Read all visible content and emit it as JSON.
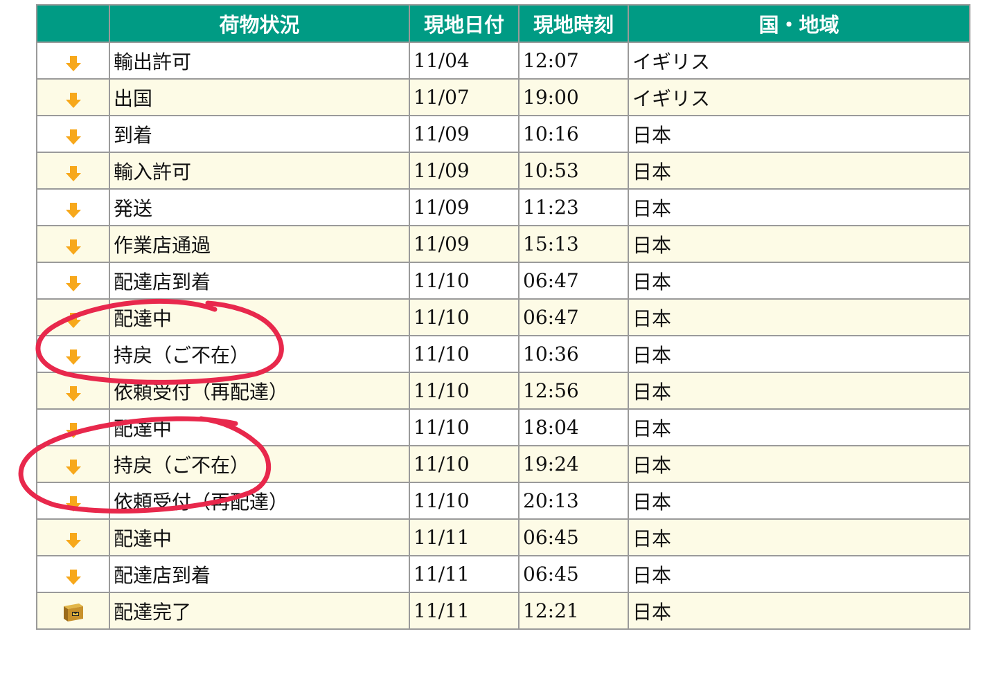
{
  "header": {
    "icon": "",
    "status": "荷物状況",
    "date": "現地日付",
    "time": "現地時刻",
    "region": "国・地域"
  },
  "rows": [
    {
      "icon": "down-arrow-icon",
      "status": "輸出許可",
      "date": "11/04",
      "time": "12:07",
      "region": "イギリス"
    },
    {
      "icon": "down-arrow-icon",
      "status": "出国",
      "date": "11/07",
      "time": "19:00",
      "region": "イギリス"
    },
    {
      "icon": "down-arrow-icon",
      "status": "到着",
      "date": "11/09",
      "time": "10:16",
      "region": "日本"
    },
    {
      "icon": "down-arrow-icon",
      "status": "輸入許可",
      "date": "11/09",
      "time": "10:53",
      "region": "日本"
    },
    {
      "icon": "down-arrow-icon",
      "status": "発送",
      "date": "11/09",
      "time": "11:23",
      "region": "日本"
    },
    {
      "icon": "down-arrow-icon",
      "status": "作業店通過",
      "date": "11/09",
      "time": "15:13",
      "region": "日本"
    },
    {
      "icon": "down-arrow-icon",
      "status": "配達店到着",
      "date": "11/10",
      "time": "06:47",
      "region": "日本"
    },
    {
      "icon": "down-arrow-icon",
      "status": "配達中",
      "date": "11/10",
      "time": "06:47",
      "region": "日本"
    },
    {
      "icon": "down-arrow-icon",
      "status": "持戻（ご不在）",
      "date": "11/10",
      "time": "10:36",
      "region": "日本"
    },
    {
      "icon": "down-arrow-icon",
      "status": "依頼受付（再配達）",
      "date": "11/10",
      "time": "12:56",
      "region": "日本"
    },
    {
      "icon": "down-arrow-icon",
      "status": "配達中",
      "date": "11/10",
      "time": "18:04",
      "region": "日本"
    },
    {
      "icon": "down-arrow-icon",
      "status": "持戻（ご不在）",
      "date": "11/10",
      "time": "19:24",
      "region": "日本"
    },
    {
      "icon": "down-arrow-icon",
      "status": "依頼受付（再配達）",
      "date": "11/10",
      "time": "20:13",
      "region": "日本"
    },
    {
      "icon": "down-arrow-icon",
      "status": "配達中",
      "date": "11/11",
      "time": "06:45",
      "region": "日本"
    },
    {
      "icon": "down-arrow-icon",
      "status": "配達店到着",
      "date": "11/11",
      "time": "06:45",
      "region": "日本"
    },
    {
      "icon": "delivered-box-icon",
      "status": "配達完了",
      "date": "11/11",
      "time": "12:21",
      "region": "日本"
    }
  ],
  "colors": {
    "header_bg": "#009b84",
    "header_text": "#ffffff",
    "row_alt_bg": "#fdfbe6",
    "arrow": "#f7a81b",
    "annotation": "#e8284c"
  }
}
